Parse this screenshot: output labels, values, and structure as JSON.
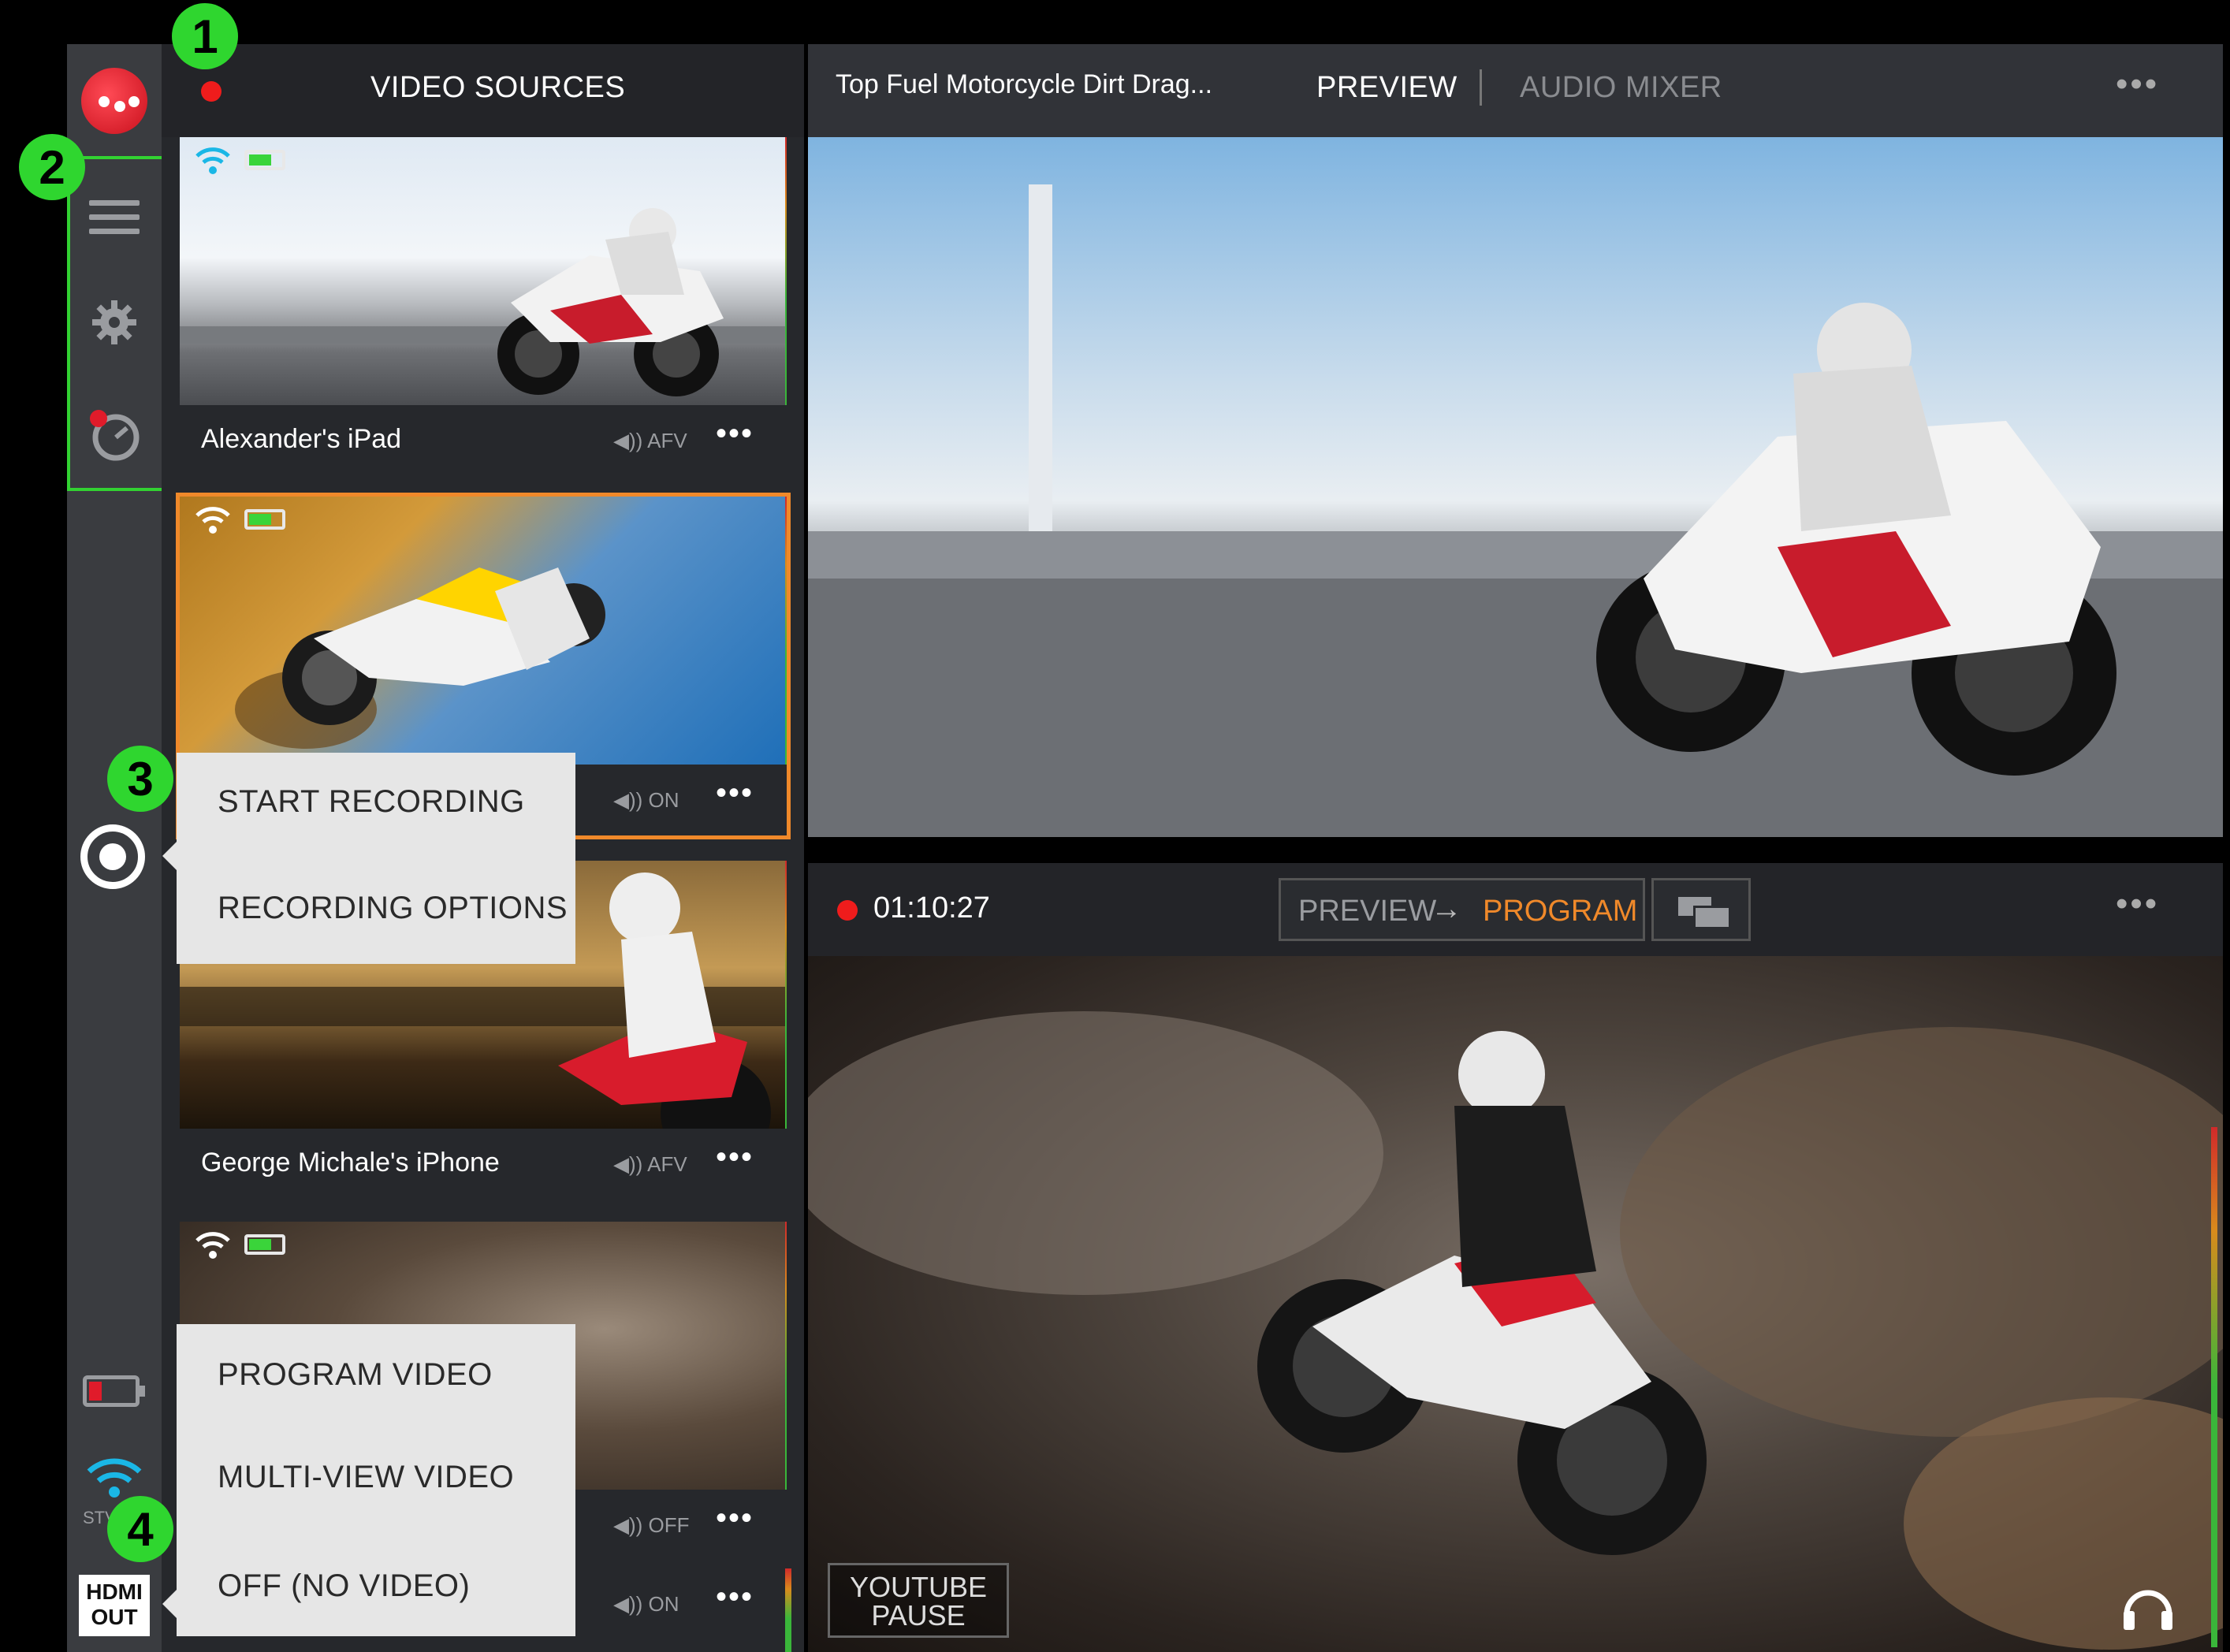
{
  "markers": [
    "1",
    "2",
    "3",
    "4"
  ],
  "video_sources": {
    "title": "VIDEO SOURCES",
    "cards": [
      {
        "name": "Alexander's iPad",
        "audio": "◀)) AFV",
        "more": "•••"
      },
      {
        "name": "",
        "audio": "◀)) ON",
        "more": "•••"
      },
      {
        "name": "George Michale's iPhone",
        "audio": "◀)) AFV",
        "more": "•••"
      },
      {
        "name": "",
        "audio": "◀)) OFF",
        "more": "•••"
      },
      {
        "name": "",
        "audio": "◀)) ON",
        "more": "•••"
      }
    ]
  },
  "record_menu": {
    "items": [
      "START RECORDING",
      "RECORDING OPTIONS"
    ]
  },
  "hdmi_menu": {
    "items": [
      "PROGRAM VIDEO",
      "MULTI-VIEW VIDEO",
      "OFF (NO VIDEO)"
    ]
  },
  "rail": {
    "hdmi_label_1": "HDMI",
    "hdmi_label_2": "OUT",
    "stream_label": "STV"
  },
  "preview": {
    "title": "Top Fuel Motorcycle Dirt Drag...",
    "tab_preview": "PREVIEW",
    "tab_audio": "AUDIO MIXER",
    "more": "•••"
  },
  "program": {
    "timer": "01:10:27",
    "btn_preview": "PREVIEW",
    "btn_arrow": "→",
    "btn_program": "PROGRAM",
    "more": "•••",
    "youtube_1": "YOUTUBE",
    "youtube_2": "PAUSE"
  },
  "colors": {
    "accent": "#f0892a",
    "record": "#ef1c1c",
    "marker": "#2fd62f",
    "rail": "#3a3c40"
  }
}
